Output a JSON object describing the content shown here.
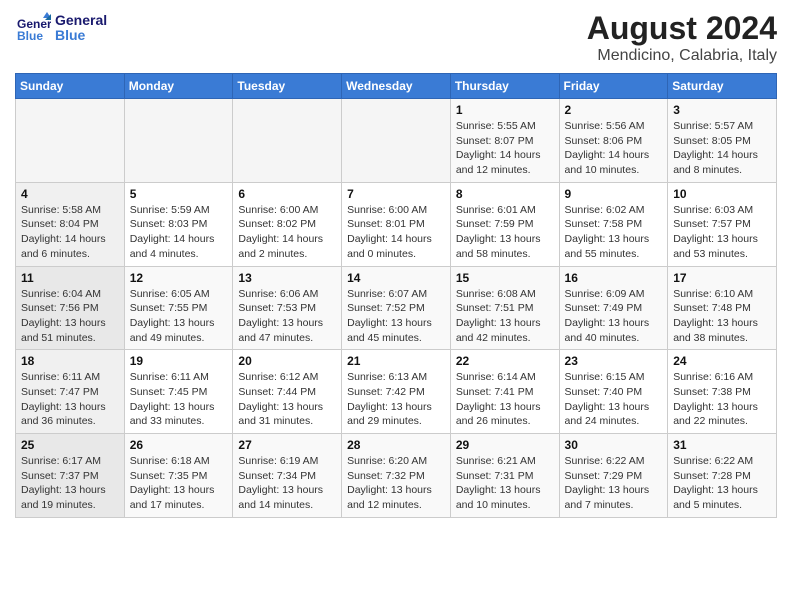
{
  "logo": {
    "line1": "General",
    "line2": "Blue"
  },
  "title": "August 2024",
  "subtitle": "Mendicino, Calabria, Italy",
  "days_of_week": [
    "Sunday",
    "Monday",
    "Tuesday",
    "Wednesday",
    "Thursday",
    "Friday",
    "Saturday"
  ],
  "weeks": [
    [
      {
        "day": "",
        "empty": true
      },
      {
        "day": "",
        "empty": true
      },
      {
        "day": "",
        "empty": true
      },
      {
        "day": "",
        "empty": true
      },
      {
        "day": "1",
        "sunrise": "5:55 AM",
        "sunset": "8:07 PM",
        "daylight": "14 hours and 12 minutes."
      },
      {
        "day": "2",
        "sunrise": "5:56 AM",
        "sunset": "8:06 PM",
        "daylight": "14 hours and 10 minutes."
      },
      {
        "day": "3",
        "sunrise": "5:57 AM",
        "sunset": "8:05 PM",
        "daylight": "14 hours and 8 minutes."
      }
    ],
    [
      {
        "day": "4",
        "sunrise": "5:58 AM",
        "sunset": "8:04 PM",
        "daylight": "14 hours and 6 minutes."
      },
      {
        "day": "5",
        "sunrise": "5:59 AM",
        "sunset": "8:03 PM",
        "daylight": "14 hours and 4 minutes."
      },
      {
        "day": "6",
        "sunrise": "6:00 AM",
        "sunset": "8:02 PM",
        "daylight": "14 hours and 2 minutes."
      },
      {
        "day": "7",
        "sunrise": "6:00 AM",
        "sunset": "8:01 PM",
        "daylight": "14 hours and 0 minutes."
      },
      {
        "day": "8",
        "sunrise": "6:01 AM",
        "sunset": "7:59 PM",
        "daylight": "13 hours and 58 minutes."
      },
      {
        "day": "9",
        "sunrise": "6:02 AM",
        "sunset": "7:58 PM",
        "daylight": "13 hours and 55 minutes."
      },
      {
        "day": "10",
        "sunrise": "6:03 AM",
        "sunset": "7:57 PM",
        "daylight": "13 hours and 53 minutes."
      }
    ],
    [
      {
        "day": "11",
        "sunrise": "6:04 AM",
        "sunset": "7:56 PM",
        "daylight": "13 hours and 51 minutes."
      },
      {
        "day": "12",
        "sunrise": "6:05 AM",
        "sunset": "7:55 PM",
        "daylight": "13 hours and 49 minutes."
      },
      {
        "day": "13",
        "sunrise": "6:06 AM",
        "sunset": "7:53 PM",
        "daylight": "13 hours and 47 minutes."
      },
      {
        "day": "14",
        "sunrise": "6:07 AM",
        "sunset": "7:52 PM",
        "daylight": "13 hours and 45 minutes."
      },
      {
        "day": "15",
        "sunrise": "6:08 AM",
        "sunset": "7:51 PM",
        "daylight": "13 hours and 42 minutes."
      },
      {
        "day": "16",
        "sunrise": "6:09 AM",
        "sunset": "7:49 PM",
        "daylight": "13 hours and 40 minutes."
      },
      {
        "day": "17",
        "sunrise": "6:10 AM",
        "sunset": "7:48 PM",
        "daylight": "13 hours and 38 minutes."
      }
    ],
    [
      {
        "day": "18",
        "sunrise": "6:11 AM",
        "sunset": "7:47 PM",
        "daylight": "13 hours and 36 minutes."
      },
      {
        "day": "19",
        "sunrise": "6:11 AM",
        "sunset": "7:45 PM",
        "daylight": "13 hours and 33 minutes."
      },
      {
        "day": "20",
        "sunrise": "6:12 AM",
        "sunset": "7:44 PM",
        "daylight": "13 hours and 31 minutes."
      },
      {
        "day": "21",
        "sunrise": "6:13 AM",
        "sunset": "7:42 PM",
        "daylight": "13 hours and 29 minutes."
      },
      {
        "day": "22",
        "sunrise": "6:14 AM",
        "sunset": "7:41 PM",
        "daylight": "13 hours and 26 minutes."
      },
      {
        "day": "23",
        "sunrise": "6:15 AM",
        "sunset": "7:40 PM",
        "daylight": "13 hours and 24 minutes."
      },
      {
        "day": "24",
        "sunrise": "6:16 AM",
        "sunset": "7:38 PM",
        "daylight": "13 hours and 22 minutes."
      }
    ],
    [
      {
        "day": "25",
        "sunrise": "6:17 AM",
        "sunset": "7:37 PM",
        "daylight": "13 hours and 19 minutes."
      },
      {
        "day": "26",
        "sunrise": "6:18 AM",
        "sunset": "7:35 PM",
        "daylight": "13 hours and 17 minutes."
      },
      {
        "day": "27",
        "sunrise": "6:19 AM",
        "sunset": "7:34 PM",
        "daylight": "13 hours and 14 minutes."
      },
      {
        "day": "28",
        "sunrise": "6:20 AM",
        "sunset": "7:32 PM",
        "daylight": "13 hours and 12 minutes."
      },
      {
        "day": "29",
        "sunrise": "6:21 AM",
        "sunset": "7:31 PM",
        "daylight": "13 hours and 10 minutes."
      },
      {
        "day": "30",
        "sunrise": "6:22 AM",
        "sunset": "7:29 PM",
        "daylight": "13 hours and 7 minutes."
      },
      {
        "day": "31",
        "sunrise": "6:22 AM",
        "sunset": "7:28 PM",
        "daylight": "13 hours and 5 minutes."
      }
    ]
  ]
}
